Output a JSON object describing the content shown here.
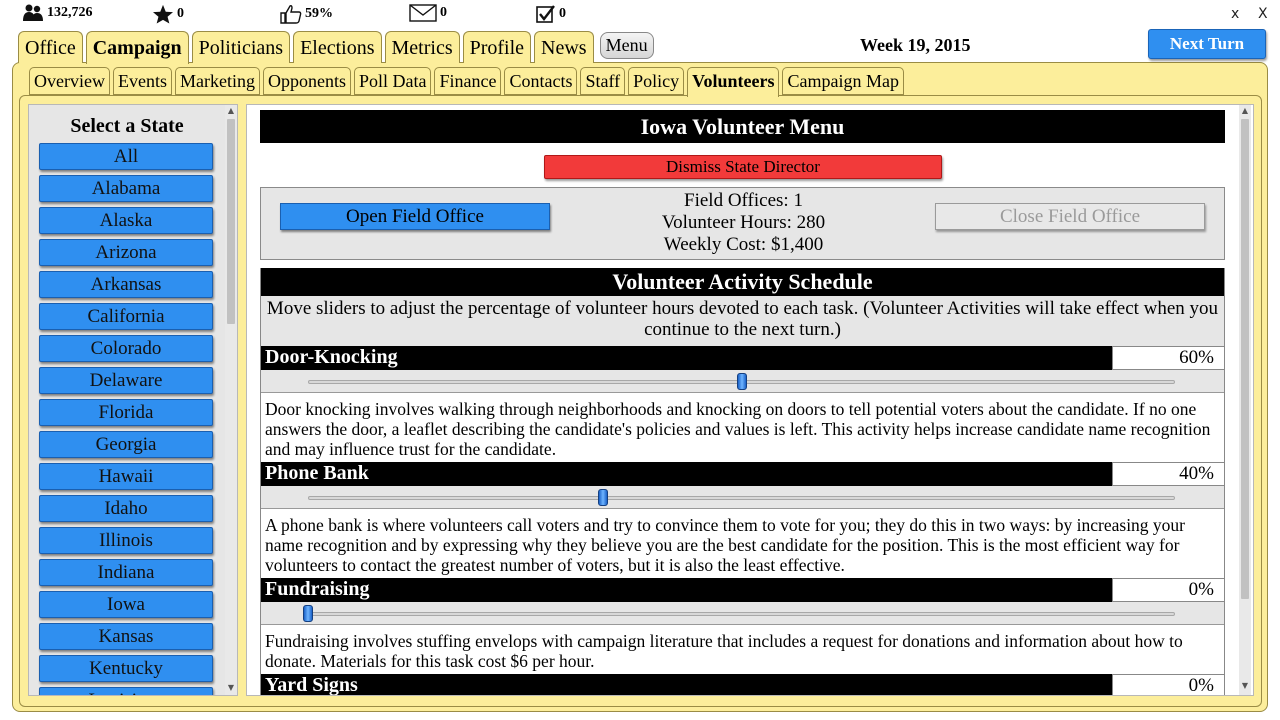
{
  "topbar": {
    "population": "132,726",
    "stars": "0",
    "approval": "59%",
    "messages": "0",
    "tasks": "0",
    "minimize": "x",
    "close": "X"
  },
  "main_tabs": [
    {
      "label": "Office",
      "active": false
    },
    {
      "label": "Campaign",
      "active": true
    },
    {
      "label": "Politicians",
      "active": false
    },
    {
      "label": "Elections",
      "active": false
    },
    {
      "label": "Metrics",
      "active": false
    },
    {
      "label": "Profile",
      "active": false
    },
    {
      "label": "News",
      "active": false
    }
  ],
  "menu_label": "Menu",
  "week": "Week 19, 2015",
  "next_turn": "Next Turn",
  "sub_tabs": [
    {
      "label": "Overview",
      "active": false
    },
    {
      "label": "Events",
      "active": false
    },
    {
      "label": "Marketing",
      "active": false
    },
    {
      "label": "Opponents",
      "active": false
    },
    {
      "label": "Poll Data",
      "active": false
    },
    {
      "label": "Finance",
      "active": false
    },
    {
      "label": "Contacts",
      "active": false
    },
    {
      "label": "Staff",
      "active": false
    },
    {
      "label": "Policy",
      "active": false
    },
    {
      "label": "Volunteers",
      "active": true
    },
    {
      "label": "Campaign Map",
      "active": false
    }
  ],
  "states": {
    "title": "Select a State",
    "items": [
      "All",
      "Alabama",
      "Alaska",
      "Arizona",
      "Arkansas",
      "California",
      "Colorado",
      "Delaware",
      "Florida",
      "Georgia",
      "Hawaii",
      "Idaho",
      "Illinois",
      "Indiana",
      "Iowa",
      "Kansas",
      "Kentucky",
      "Louisiana"
    ]
  },
  "volunteer": {
    "title": "Iowa Volunteer Menu",
    "dismiss": "Dismiss State Director",
    "open_office": "Open Field Office",
    "close_office": "Close Field Office",
    "field_offices": "Field Offices: 1",
    "volunteer_hours": "Volunteer Hours: 280",
    "weekly_cost": "Weekly Cost: $1,400",
    "schedule_title": "Volunteer Activity Schedule",
    "schedule_intro": "Move sliders to adjust the percentage of volunteer hours devoted to each task. (Volunteer Activities will take effect when you continue to the next turn.)",
    "activities": [
      {
        "name": "Door-Knocking",
        "percent_label": "60%",
        "slider_fraction": 0.5,
        "description": "Door knocking involves walking through neighborhoods and knocking on doors to tell potential voters about the candidate. If no one answers the door, a leaflet describing the candidate's policies and values is left. This activity helps increase candidate name recognition and may influence trust for the candidate."
      },
      {
        "name": "Phone Bank",
        "percent_label": "40%",
        "slider_fraction": 0.34,
        "description": "A phone bank is where volunteers call voters and try to convince them to vote for you; they do this in two ways: by increasing your name recognition and by expressing why they believe you are the best candidate for the position. This is the most efficient way for volunteers to contact the greatest number of voters, but it is also the least effective."
      },
      {
        "name": "Fundraising",
        "percent_label": "0%",
        "slider_fraction": 0.0,
        "description": "Fundraising involves stuffing envelops with campaign literature that includes a request for donations and information about how to donate. Materials for this task cost $6 per hour."
      },
      {
        "name": "Yard Signs",
        "percent_label": "0%",
        "slider_fraction": 0.0,
        "description": ""
      }
    ]
  }
}
